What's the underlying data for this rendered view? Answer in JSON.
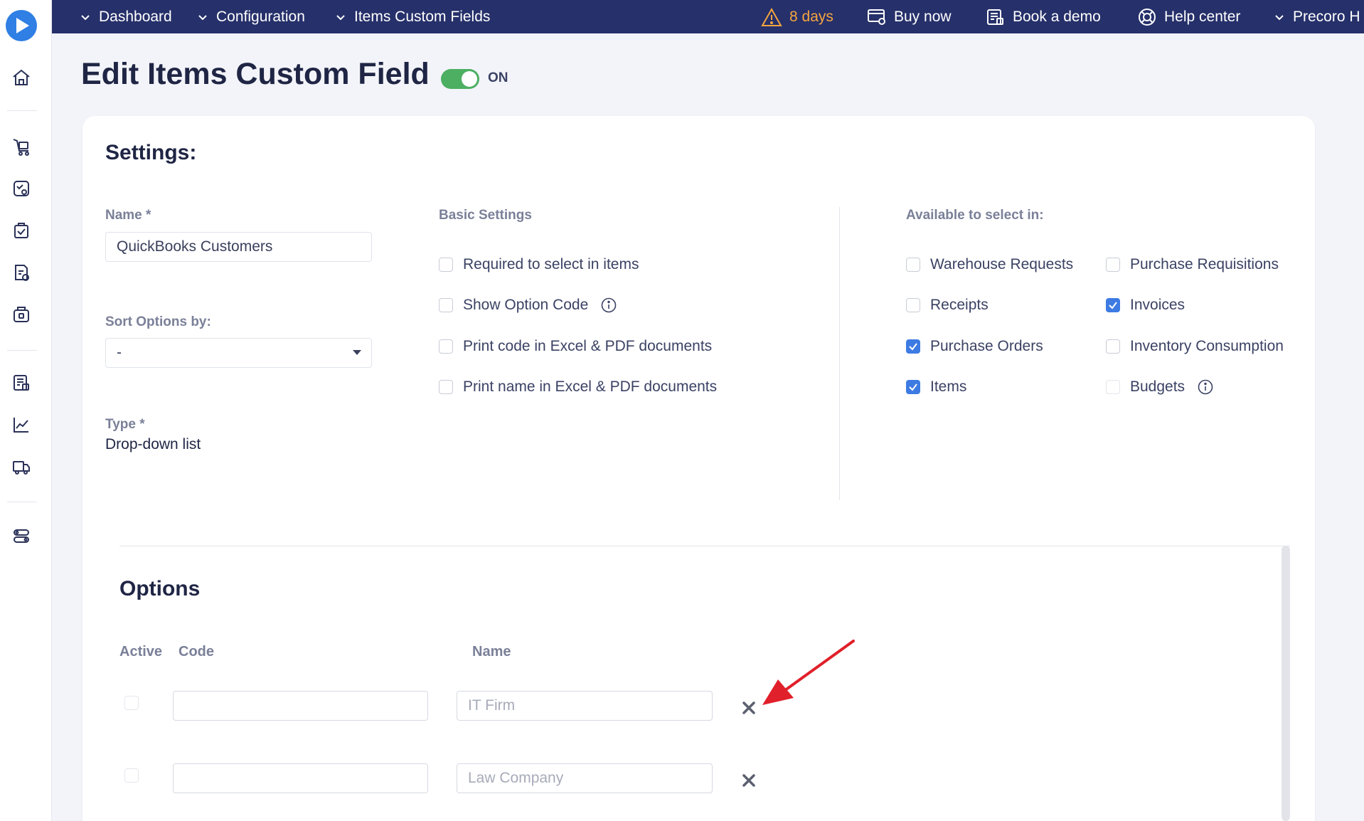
{
  "nav": {
    "crumbs": [
      "Dashboard",
      "Configuration",
      "Items Custom Fields"
    ],
    "trial": "8 days",
    "buy_now": "Buy now",
    "book_demo": "Book a demo",
    "help_center": "Help center",
    "account": "Precoro H"
  },
  "page": {
    "title": "Edit Items Custom Field",
    "status_label": "ON",
    "status_on": true
  },
  "settings": {
    "title": "Settings:",
    "name_label": "Name *",
    "name_value": "QuickBooks Customers",
    "sort_label": "Sort Options by:",
    "sort_value": "-",
    "type_label": "Type *",
    "type_value": "Drop-down list",
    "basic_title": "Basic Settings",
    "basic": [
      {
        "label": "Required to select in items",
        "checked": false
      },
      {
        "label": "Show Option Code",
        "checked": false,
        "info": true
      },
      {
        "label": "Print code in Excel & PDF documents",
        "checked": false
      },
      {
        "label": "Print name in Excel & PDF documents",
        "checked": false
      }
    ],
    "available_title": "Available to select in:",
    "available": [
      {
        "label": "Warehouse Requests",
        "checked": false
      },
      {
        "label": "Purchase Requisitions",
        "checked": false
      },
      {
        "label": "Receipts",
        "checked": false
      },
      {
        "label": "Invoices",
        "checked": true
      },
      {
        "label": "Purchase Orders",
        "checked": true
      },
      {
        "label": "Inventory Consumption",
        "checked": false
      },
      {
        "label": "Items",
        "checked": true
      },
      {
        "label": "Budgets",
        "checked": false,
        "info": true
      }
    ]
  },
  "options": {
    "title": "Options",
    "col_active": "Active",
    "col_code": "Code",
    "col_name": "Name",
    "rows": [
      {
        "active": false,
        "code": "",
        "name_placeholder": "IT Firm"
      },
      {
        "active": false,
        "code": "",
        "name_placeholder": "Law Company"
      }
    ]
  },
  "colors": {
    "nav_bg": "#26306a",
    "accent": "#3d7be3",
    "toggle_on": "#4caf62",
    "warning": "#f5a540",
    "annotation": "#e0202a"
  }
}
